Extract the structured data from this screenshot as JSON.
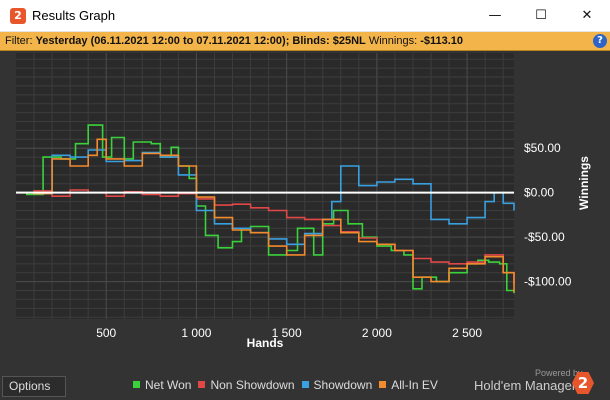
{
  "window": {
    "title": "Results Graph",
    "minimize": "—",
    "maximize": "☐",
    "close": "✕"
  },
  "filter": {
    "label": "Filter: ",
    "period": "Yesterday (06.11.2021 12:00 to 07.11.2021 12:00); Blinds: $25NL",
    "winnings_label": " Winnings: ",
    "winnings_value": "-$113.10",
    "help_icon": "?"
  },
  "options_label": "Options",
  "powered_by": "Powered by",
  "brand": "Hold'em Manager",
  "brand_logo": "2",
  "chart_data": {
    "type": "line",
    "xlabel": "Hands",
    "ylabel": "Winnings",
    "xlim": [
      0,
      2760
    ],
    "ylim": [
      -142,
      157
    ],
    "x_ticks": [
      500,
      1000,
      1500,
      2000,
      2500
    ],
    "x_tick_labels": [
      "500",
      "1 000",
      "1 500",
      "2 000",
      "2 500"
    ],
    "y_ticks": [
      50,
      0,
      -50,
      -100
    ],
    "y_tick_labels": [
      "$50.00",
      "$0.00",
      "-$50.00",
      "-$100.00"
    ],
    "grid": true,
    "legend_position": "bottom",
    "series": [
      {
        "name": "Net Won",
        "color": "#3ad23a",
        "x": [
          0,
          60,
          150,
          250,
          330,
          400,
          480,
          530,
          600,
          650,
          750,
          800,
          860,
          900,
          960,
          1000,
          1050,
          1120,
          1200,
          1250,
          1300,
          1400,
          1500,
          1560,
          1650,
          1700,
          1760,
          1840,
          1920,
          2000,
          2080,
          2150,
          2200,
          2250,
          2330,
          2400,
          2500,
          2560,
          2620,
          2680,
          2720,
          2760
        ],
        "y": [
          0,
          -2,
          40,
          38,
          55,
          76,
          40,
          62,
          38,
          57,
          55,
          40,
          51,
          30,
          16,
          -15,
          -48,
          -62,
          -55,
          -40,
          -38,
          -70,
          -65,
          -40,
          -70,
          -35,
          -20,
          -35,
          -50,
          -60,
          -65,
          -70,
          -108,
          -95,
          -100,
          -90,
          -80,
          -76,
          -78,
          -80,
          -110,
          -113
        ]
      },
      {
        "name": "Non Showdown",
        "color": "#e04848",
        "x": [
          0,
          100,
          200,
          300,
          400,
          500,
          600,
          700,
          800,
          900,
          1000,
          1100,
          1200,
          1300,
          1400,
          1500,
          1600,
          1700,
          1800,
          1900,
          2000,
          2100,
          2200,
          2300,
          2400,
          2500,
          2600,
          2700,
          2760
        ],
        "y": [
          0,
          2,
          -4,
          3,
          0,
          -4,
          1,
          -2,
          -4,
          -1,
          -7,
          -14,
          -13,
          -17,
          -20,
          -28,
          -30,
          -37,
          -44,
          -51,
          -58,
          -65,
          -74,
          -78,
          -80,
          -78,
          -70,
          -90,
          -103
        ]
      },
      {
        "name": "Showdown",
        "color": "#3aa0e0",
        "x": [
          0,
          100,
          200,
          300,
          400,
          500,
          600,
          700,
          800,
          900,
          1000,
          1100,
          1200,
          1300,
          1400,
          1500,
          1600,
          1700,
          1750,
          1800,
          1900,
          2000,
          2100,
          2200,
          2300,
          2400,
          2500,
          2600,
          2650,
          2700,
          2760
        ],
        "y": [
          0,
          -1,
          42,
          40,
          48,
          35,
          36,
          45,
          40,
          20,
          -20,
          -35,
          -40,
          -45,
          -52,
          -58,
          -46,
          -30,
          -10,
          30,
          8,
          12,
          15,
          10,
          -30,
          -35,
          -28,
          -10,
          0,
          -12,
          -20
        ]
      },
      {
        "name": "All-In EV",
        "color": "#f28a2e",
        "x": [
          0,
          100,
          200,
          300,
          400,
          450,
          500,
          600,
          700,
          800,
          900,
          1000,
          1100,
          1200,
          1300,
          1400,
          1500,
          1600,
          1700,
          1800,
          1900,
          2000,
          2100,
          2200,
          2300,
          2400,
          2500,
          2600,
          2700,
          2760
        ],
        "y": [
          0,
          -1,
          38,
          30,
          42,
          60,
          38,
          30,
          44,
          42,
          30,
          -5,
          -28,
          -42,
          -45,
          -60,
          -70,
          -48,
          -30,
          -45,
          -55,
          -58,
          -65,
          -95,
          -100,
          -85,
          -80,
          -72,
          -90,
          -112
        ]
      }
    ]
  }
}
